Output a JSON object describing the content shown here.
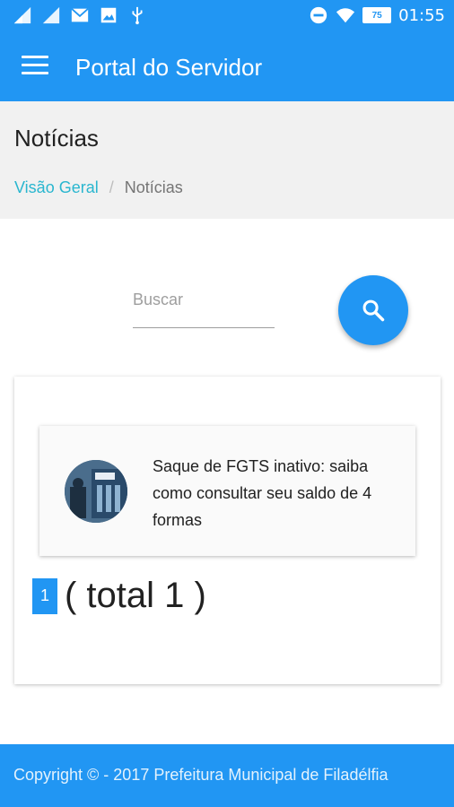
{
  "status_bar": {
    "time": "01:55",
    "battery": "75",
    "left_icons": [
      "signal-icon",
      "signal-icon",
      "mail-icon",
      "image-icon",
      "usb-icon"
    ],
    "right_icons": [
      "dnd-icon",
      "wifi-icon",
      "battery-icon"
    ]
  },
  "app_bar": {
    "title": "Portal do Servidor",
    "menu_icon": "menu-icon"
  },
  "header": {
    "title": "Notícias",
    "breadcrumb": {
      "home": "Visão Geral",
      "separator": "/",
      "current": "Notícias"
    }
  },
  "search": {
    "placeholder": "Buscar",
    "value": "",
    "button_icon": "search-icon"
  },
  "news": [
    {
      "title": "Saque de FGTS inativo: saiba como consultar seu saldo de 4 formas",
      "thumb_icon": "news-thumbnail"
    }
  ],
  "pagination": {
    "current_page": "1",
    "total_label": "( total 1 )"
  },
  "footer": {
    "text": "Copyright © - 2017 Prefeitura Municipal de Filadélfia"
  },
  "colors": {
    "primary": "#2196f3",
    "breadcrumb_link": "#29b6cf",
    "header_bg": "#f1f1f1"
  }
}
